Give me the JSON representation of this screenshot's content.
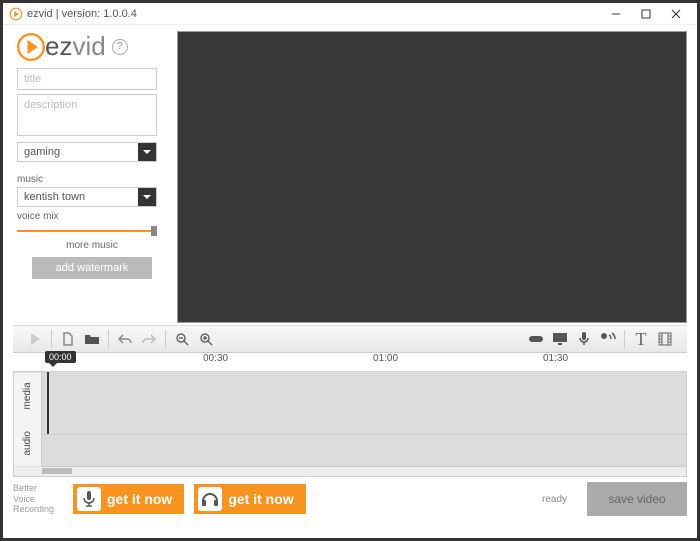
{
  "window": {
    "title": "ezvid | version: 1.0.0.4"
  },
  "logo": {
    "brand_ez": "ez",
    "brand_vid": "vid"
  },
  "fields": {
    "title_placeholder": "title",
    "title_value": "",
    "desc_placeholder": "description",
    "desc_value": "",
    "category_value": "gaming"
  },
  "music": {
    "label": "music",
    "selected": "kentish town",
    "voice_mix_label": "voice mix",
    "more_music": "more music"
  },
  "buttons": {
    "watermark": "add watermark",
    "save": "save video"
  },
  "timeline": {
    "playhead": "00:00",
    "marks": [
      "00:30",
      "01:00",
      "01:30"
    ],
    "tracks": {
      "media": "media",
      "audio": "audio"
    }
  },
  "footer": {
    "better_l1": "Better",
    "better_l2": "Voice",
    "better_l3": "Recording",
    "promo1": "get it now",
    "promo2": "get it now",
    "status": "ready"
  }
}
